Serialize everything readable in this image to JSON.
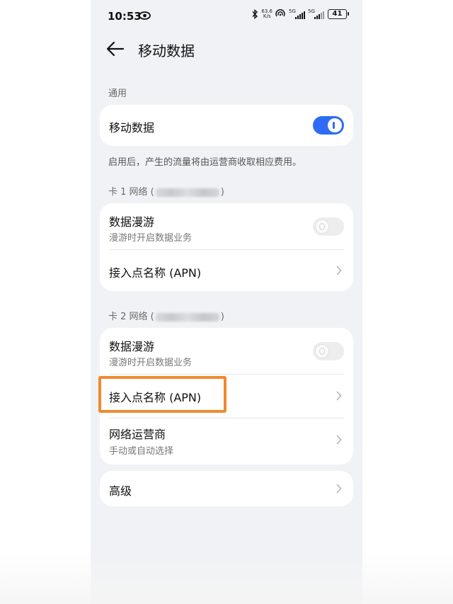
{
  "status_bar": {
    "time": "10:53",
    "speed_value": "63.6",
    "speed_unit": "K/s",
    "sim1_label": "5G",
    "sim2_label": "5G",
    "battery": "41"
  },
  "header": {
    "title": "移动数据"
  },
  "general": {
    "section_label": "通用",
    "mobile_data_label": "移动数据",
    "mobile_data_on": true,
    "note": "启用后，产生的流量将由运营商收取相应费用。"
  },
  "sim1": {
    "section_label": "卡 1 网络 (",
    "roaming_title": "数据漫游",
    "roaming_subtitle": "漫游时开启数据业务",
    "apn_label": "接入点名称 (APN)"
  },
  "sim2": {
    "section_label": "卡 2 网络 (",
    "roaming_title": "数据漫游",
    "roaming_subtitle": "漫游时开启数据业务",
    "apn_label": "接入点名称 (APN)",
    "operator_title": "网络运营商",
    "operator_subtitle": "手动或自动选择"
  },
  "advanced": {
    "label": "高级"
  },
  "colors": {
    "accent": "#2f6cf5",
    "highlight": "#f08a2e",
    "background": "#f1f2f5"
  }
}
